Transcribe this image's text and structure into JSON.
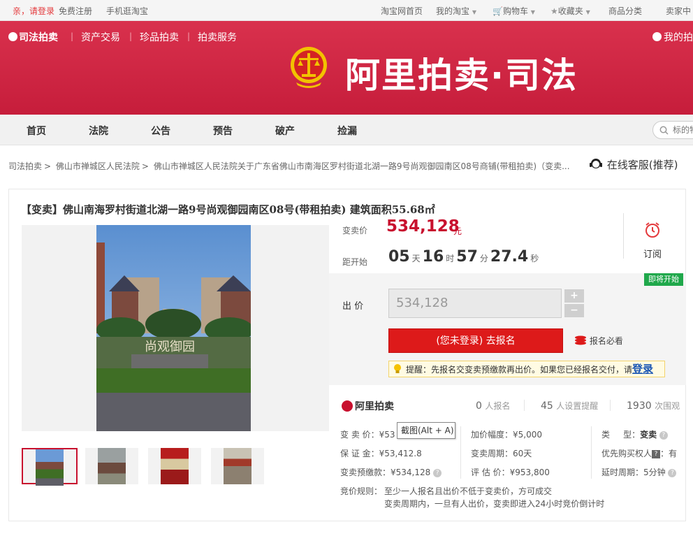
{
  "colors": {
    "brand": "#c61d3b",
    "price": "#c8102e",
    "cta": "#dd1a1a",
    "soon": "#20a84b"
  },
  "topbar": {
    "greeting": "亲，请登录",
    "register": "免费注册",
    "mobile": "手机逛淘宝",
    "taobao_home": "淘宝网首页",
    "my_taobao": "我的淘宝",
    "cart": "购物车",
    "favorites": "收藏夹",
    "categories": "商品分类",
    "seller_center": "卖家中"
  },
  "banner": {
    "brand_small": "司法拍卖",
    "links": [
      "资产交易",
      "珍品拍卖",
      "拍卖服务"
    ],
    "brand_big": "阿里拍卖·司法",
    "my_auction": "我的拍"
  },
  "mainnav": {
    "tabs": [
      "首页",
      "法院",
      "公告",
      "预告",
      "破产",
      "捡漏"
    ],
    "search_placeholder": "标的物"
  },
  "breadcrumb": {
    "items": [
      "司法拍卖",
      "佛山市禅城区人民法院",
      "佛山市禅城区人民法院关于广东省佛山市南海区罗村街道北湖一路9号尚观御园南区08号商铺(带租拍卖)（变卖..."
    ],
    "service": "在线客服(推荐)"
  },
  "item": {
    "title": "【变卖】佛山南海罗村街道北湖一路9号尚观御园南区08号(带租拍卖) 建筑面积55.68㎡",
    "price_label": "变卖价",
    "price": "534,128",
    "price_unit": "元",
    "countdown_label": "距开始",
    "days": "05",
    "days_unit": "天",
    "hours": "16",
    "hours_unit": "时",
    "minutes": "57",
    "minutes_unit": "分",
    "seconds": "27.4",
    "seconds_unit": "秒",
    "subscribe": "订阅",
    "soon_badge": "即将开始",
    "bid_label": "出 价",
    "bid_value": "534,128",
    "plus": "+",
    "minus": "−",
    "signup_button": "(您未登录) 去报名",
    "must_read": "报名必看",
    "notice_text": "提醒：先报名交变卖预缴款再出价。如果您已经报名交付，请",
    "notice_login": "登录",
    "logo_text": "阿里拍卖",
    "stats": [
      {
        "num": "0",
        "unit": "人报名"
      },
      {
        "num": "45",
        "unit": "人设置提醒"
      },
      {
        "num": "1930",
        "unit": "次围观"
      }
    ],
    "details": {
      "start_price": "变 卖 价：¥53",
      "deposit": "保 证 金：¥53,412.8",
      "prepay": "变卖预缴款：¥534,128",
      "increment": "加价幅度：¥5,000",
      "period": "变卖周期：60天",
      "appraisal": "评 估 价：¥953,800",
      "type_label": "类     型：",
      "type_value": "变卖",
      "priority": "优先购买权人",
      "priority_badge": "?",
      "priority_value": "：有",
      "delay": "延时周期：5分钟"
    },
    "rule_label": "竞价规则：",
    "rule_line1": "至少一人报名且出价不低于变卖价，方可成交",
    "rule_line2": "变卖周期内，一旦有人出价，变卖即进入24小时竞价倒计时",
    "tooltip": "截图(Alt + A)"
  }
}
